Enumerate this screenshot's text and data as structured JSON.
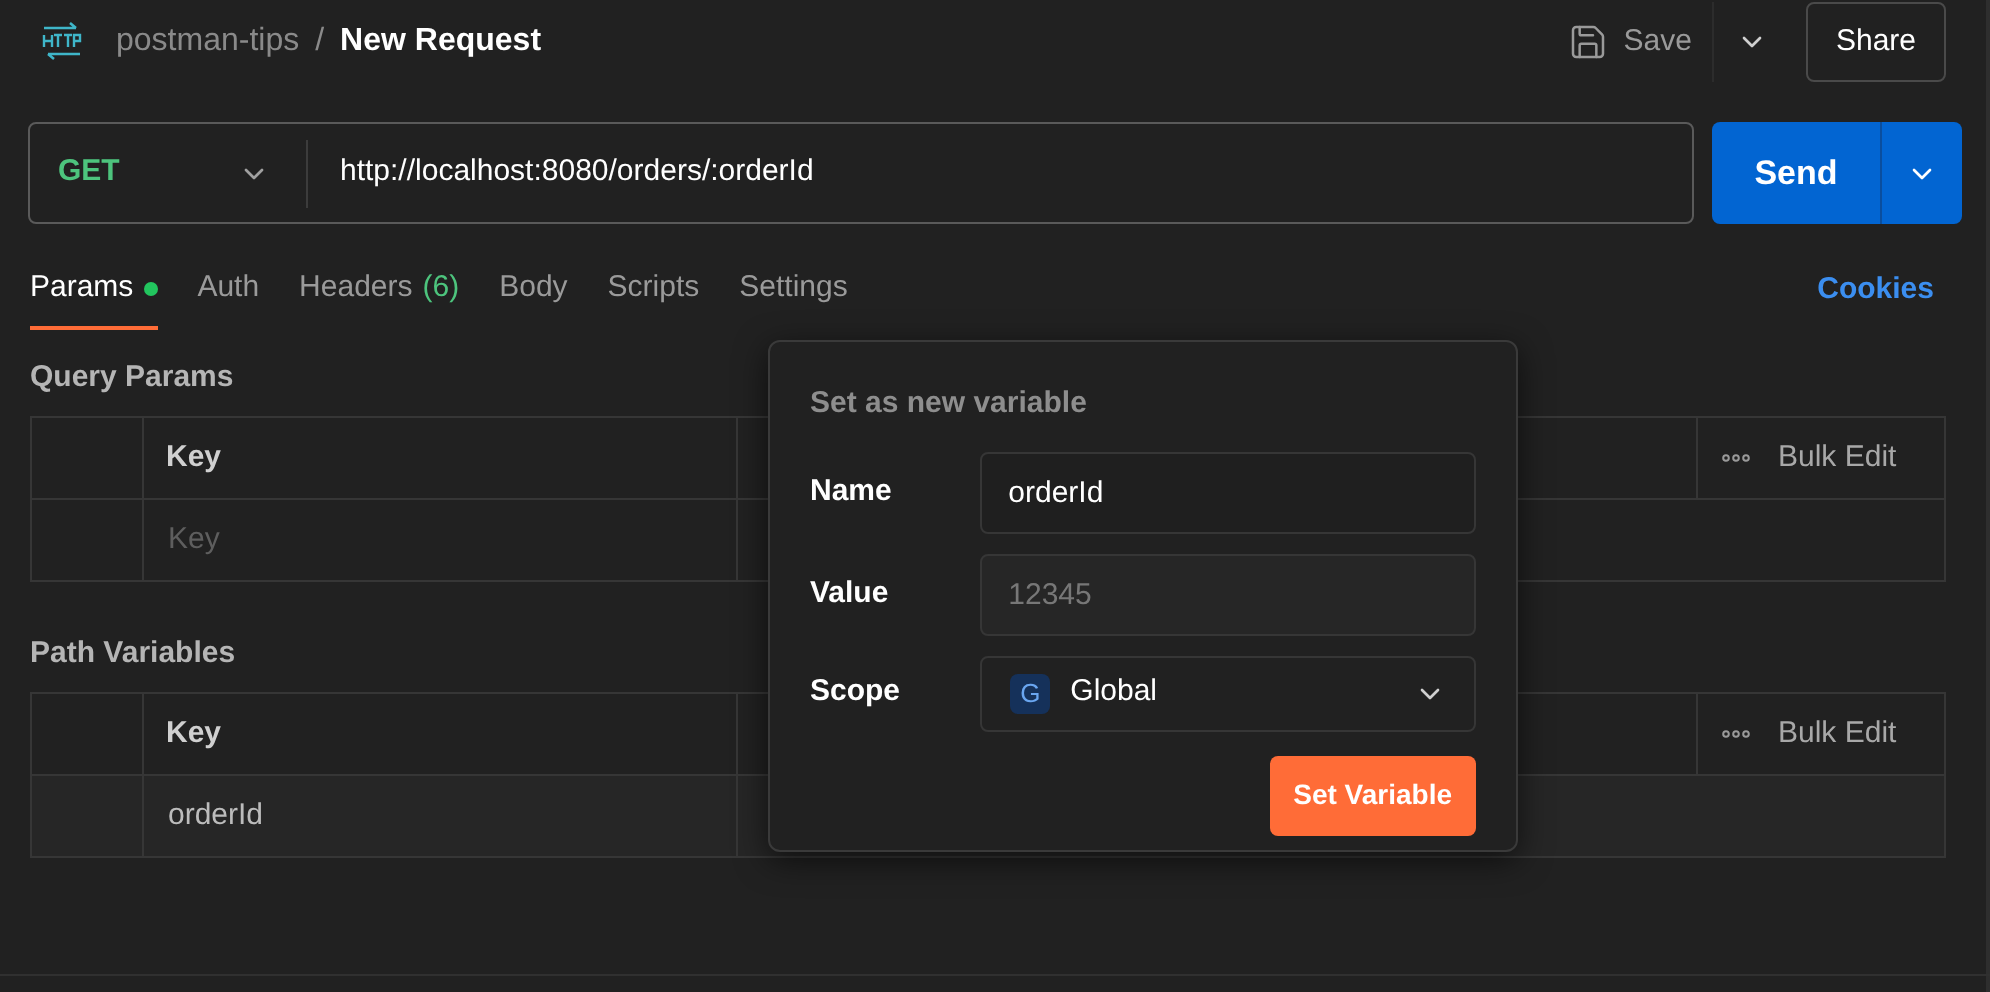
{
  "header": {
    "collection": "postman-tips",
    "separator": "/",
    "request": "New Request",
    "save": "Save",
    "share": "Share"
  },
  "request": {
    "method": "GET",
    "url": "http://localhost:8080/orders/:orderId",
    "send": "Send"
  },
  "tabs": [
    {
      "label": "Params",
      "selected": true,
      "dot": true
    },
    {
      "label": "Auth",
      "selected": false,
      "dot": false
    },
    {
      "label": "Headers",
      "count": "(6)",
      "selected": false,
      "dot": false
    },
    {
      "label": "Body",
      "selected": false,
      "dot": false
    },
    {
      "label": "Scripts",
      "selected": false,
      "dot": false
    },
    {
      "label": "Settings",
      "selected": false,
      "dot": false
    }
  ],
  "cookies": "Cookies",
  "tables": [
    {
      "title": "Query Params",
      "key_header": "Key",
      "bulk_edit": "Bulk Edit",
      "rows": [
        {
          "key_placeholder": "Key"
        }
      ]
    },
    {
      "title": "Path Variables",
      "key_header": "Key",
      "bulk_edit": "Bulk Edit",
      "rows": [
        {
          "key": "orderId"
        }
      ]
    }
  ],
  "popover": {
    "title": "Set as new variable",
    "fields": [
      {
        "kind": "text",
        "label": "Name",
        "value": "orderId"
      },
      {
        "kind": "text",
        "label": "Value",
        "placeholder": "12345"
      },
      {
        "kind": "select",
        "label": "Scope",
        "badge": "G",
        "value": "Global"
      }
    ],
    "button": "Set Variable"
  }
}
